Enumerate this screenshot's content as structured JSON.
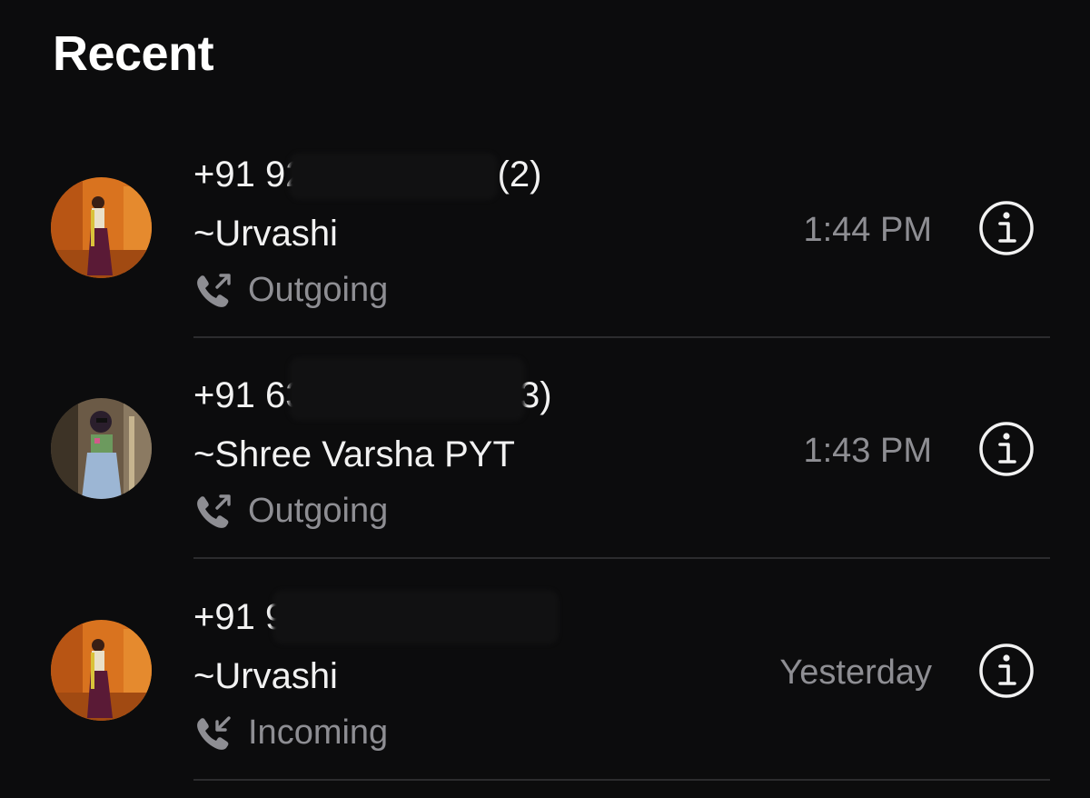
{
  "header": {
    "title": "Recent"
  },
  "calls": [
    {
      "number": "+91 92800 85245",
      "count": "(2)",
      "name": "~Urvashi",
      "type": "Outgoing",
      "direction_icon": "outgoing-call-icon",
      "time": "1:44 PM",
      "avatar": "photo-urvashi"
    },
    {
      "number": "+91 6335 153 834",
      "count": "(3)",
      "name": "~Shree Varsha PYT",
      "type": "Outgoing",
      "direction_icon": "outgoing-call-icon",
      "time": "1:43 PM",
      "avatar": "photo-shree-varsha"
    },
    {
      "number": "+91 92800 85245",
      "count": "",
      "name": "~Urvashi",
      "type": "Incoming",
      "direction_icon": "incoming-call-icon",
      "time": "Yesterday",
      "avatar": "photo-urvashi"
    }
  ],
  "colors": {
    "background": "#0c0c0d",
    "primary_text": "#f2f2f2",
    "secondary_text": "#8e8e93",
    "divider": "#2c2c2e"
  }
}
